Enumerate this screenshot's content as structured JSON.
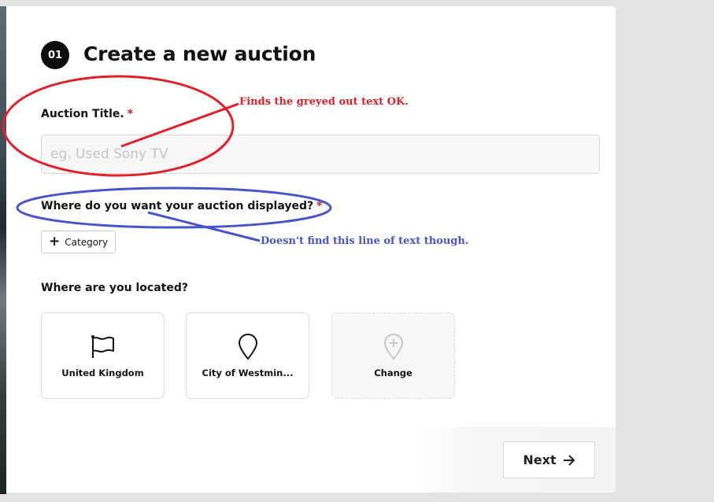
{
  "form": {
    "step_number": "01",
    "title": "Create a new auction",
    "auction_title": {
      "label": "Auction Title.",
      "required_mark": "*",
      "value": "",
      "placeholder": "eg. Used Sony TV"
    },
    "display": {
      "label": "Where do you want your auction displayed?",
      "required_mark": "*",
      "category_button_label": "Category",
      "category_button_icon": "plus-icon"
    },
    "location": {
      "label": "Where are you located?",
      "options": [
        {
          "label": "United Kingdom",
          "icon": "flag-icon"
        },
        {
          "label": "City of Westmin...",
          "icon": "map-pin-icon"
        },
        {
          "label": "Change",
          "icon": "map-pin-plus-icon"
        }
      ]
    },
    "next_button": {
      "label": "Next",
      "icon": "arrow-right-icon"
    }
  },
  "annotations": {
    "red_note": "Finds the greyed out text OK.",
    "blue_note": "Doesn't find this line of text though.",
    "red_color": "#e0202a",
    "blue_color": "#4a54c8"
  }
}
